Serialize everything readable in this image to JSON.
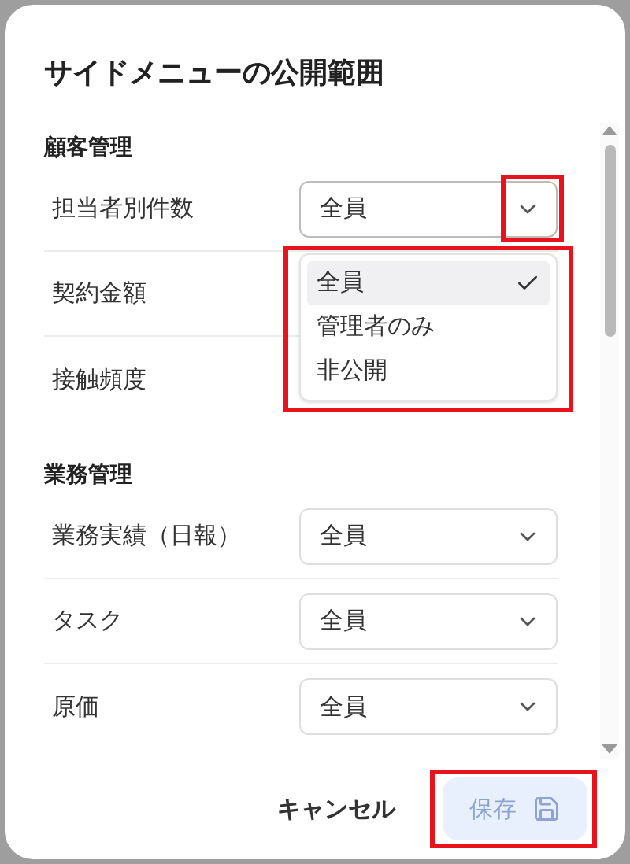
{
  "dialog": {
    "title": "サイドメニューの公開範囲"
  },
  "sections": [
    {
      "heading": "顧客管理",
      "rows": [
        {
          "label": "担当者別件数",
          "value": "全員",
          "open": true,
          "annotated": true,
          "menu": {
            "annotated": true,
            "options": [
              {
                "label": "全員",
                "selected": true
              },
              {
                "label": "管理者のみ",
                "selected": false
              },
              {
                "label": "非公開",
                "selected": false
              }
            ]
          }
        },
        {
          "label": "契約金額"
        },
        {
          "label": "接触頻度"
        }
      ]
    },
    {
      "heading": "業務管理",
      "rows": [
        {
          "label": "業務実績（日報）",
          "value": "全員",
          "open": false
        },
        {
          "label": "タスク",
          "value": "全員",
          "open": false
        },
        {
          "label": "原価",
          "value": "全員",
          "open": false
        }
      ]
    }
  ],
  "footer": {
    "cancel": "キャンセル",
    "save": {
      "label": "保存",
      "disabled": true,
      "annotated": true
    }
  }
}
